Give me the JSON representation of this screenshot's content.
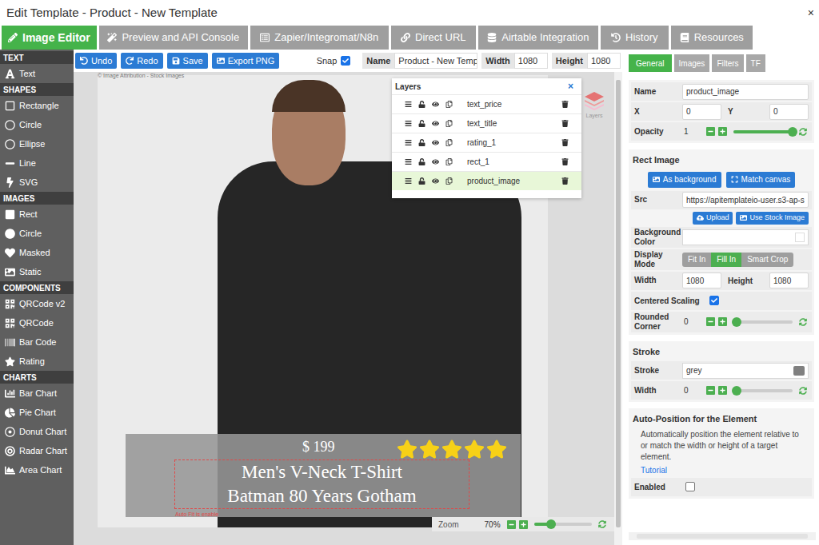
{
  "window": {
    "title": "Edit Template - Product - New Template",
    "close": "×"
  },
  "tabs": [
    {
      "label": "Image Editor",
      "selected": true
    },
    {
      "label": "Preview and API Console",
      "selected": false
    },
    {
      "label": "Zapier/Integromat/N8n",
      "selected": false
    },
    {
      "label": "Direct URL",
      "selected": false
    },
    {
      "label": "Airtable Integration",
      "selected": false
    },
    {
      "label": "History",
      "selected": false
    },
    {
      "label": "Resources",
      "selected": false
    }
  ],
  "sidebar": {
    "sections": [
      {
        "title": "TEXT",
        "items": [
          {
            "label": "Text"
          }
        ]
      },
      {
        "title": "SHAPES",
        "items": [
          {
            "label": "Rectangle"
          },
          {
            "label": "Circle"
          },
          {
            "label": "Ellipse"
          },
          {
            "label": "Line"
          },
          {
            "label": "SVG"
          }
        ]
      },
      {
        "title": "IMAGES",
        "items": [
          {
            "label": "Rect"
          },
          {
            "label": "Circle"
          },
          {
            "label": "Masked"
          },
          {
            "label": "Static"
          }
        ]
      },
      {
        "title": "COMPONENTS",
        "items": [
          {
            "label": "QRCode v2"
          },
          {
            "label": "QRCode"
          },
          {
            "label": "Bar Code"
          },
          {
            "label": "Rating"
          }
        ]
      },
      {
        "title": "CHARTS",
        "items": [
          {
            "label": "Bar Chart"
          },
          {
            "label": "Pie Chart"
          },
          {
            "label": "Donut Chart"
          },
          {
            "label": "Radar Chart"
          },
          {
            "label": "Area Chart"
          }
        ]
      }
    ]
  },
  "toolbar": {
    "buttons": [
      "Undo",
      "Redo",
      "Save",
      "Export PNG"
    ],
    "snap": {
      "label": "Snap",
      "checked": true
    },
    "fields": [
      {
        "label": "Name",
        "value": "Product - New Temp"
      },
      {
        "label": "Width",
        "value": "1080"
      },
      {
        "label": "Height",
        "value": "1080"
      }
    ]
  },
  "canvas": {
    "attribution": "© Image Attribution - Stock Images",
    "price": "$ 199",
    "rating": {
      "stars": 5
    },
    "title_lines": [
      "Men's V-Neck T-Shirt",
      "Batman 80 Years Gotham"
    ],
    "autofit_note": "Auto Fit is enable"
  },
  "layers": {
    "title": "Layers",
    "close": "×",
    "side_label": "Layers",
    "items": [
      {
        "name": "text_price",
        "selected": false
      },
      {
        "name": "text_title",
        "selected": false
      },
      {
        "name": "rating_1",
        "selected": false
      },
      {
        "name": "rect_1",
        "selected": false
      },
      {
        "name": "product_image",
        "selected": true
      }
    ]
  },
  "zoom": {
    "label": "Zoom",
    "reading": "70%",
    "level": 0.3
  },
  "panel": {
    "tabs": [
      {
        "label": "General",
        "selected": true
      },
      {
        "label": "Images",
        "selected": false
      },
      {
        "label": "Filters",
        "selected": false
      },
      {
        "label": "TF",
        "selected": false
      }
    ],
    "name": {
      "label": "Name",
      "value": "product_image"
    },
    "x": {
      "label": "X",
      "value": "0"
    },
    "y": {
      "label": "Y",
      "value": "0"
    },
    "opacity": {
      "label": "Opacity",
      "value": "1",
      "level": 1
    },
    "rect_image": {
      "title": "Rect Image",
      "buttons": [
        "As background",
        "Match canvas"
      ],
      "src": {
        "label": "Src",
        "value": "https://apitemplateio-user.s3-ap-s"
      },
      "upload_buttons": [
        "Upload",
        "Use Stock Image"
      ],
      "background_color": {
        "label": "Background Color",
        "value": ""
      },
      "display_mode": {
        "label": "Display Mode",
        "options": [
          {
            "label": "Fit In",
            "selected": false
          },
          {
            "label": "Fill In",
            "selected": true
          },
          {
            "label": "Smart Crop",
            "selected": false
          }
        ]
      },
      "width": {
        "label": "Width",
        "value": "1080"
      },
      "height": {
        "label": "Height",
        "value": "1080"
      },
      "centered_scaling": {
        "label": "Centered Scaling",
        "checked": true
      },
      "rounded_corner": {
        "label": "Rounded Corner",
        "value": "0",
        "level": 0.05
      }
    },
    "stroke": {
      "title": "Stroke",
      "stroke": {
        "label": "Stroke",
        "value": "grey",
        "color": "#808080"
      },
      "width": {
        "label": "Width",
        "value": "0",
        "level": 0.05
      }
    },
    "auto_position": {
      "title": "Auto-Position for the Element",
      "description": "Automatically position the element relative to or match the width or height of a target element.",
      "link": "Tutorial",
      "enabled": {
        "label": "Enabled",
        "checked": false
      }
    }
  }
}
